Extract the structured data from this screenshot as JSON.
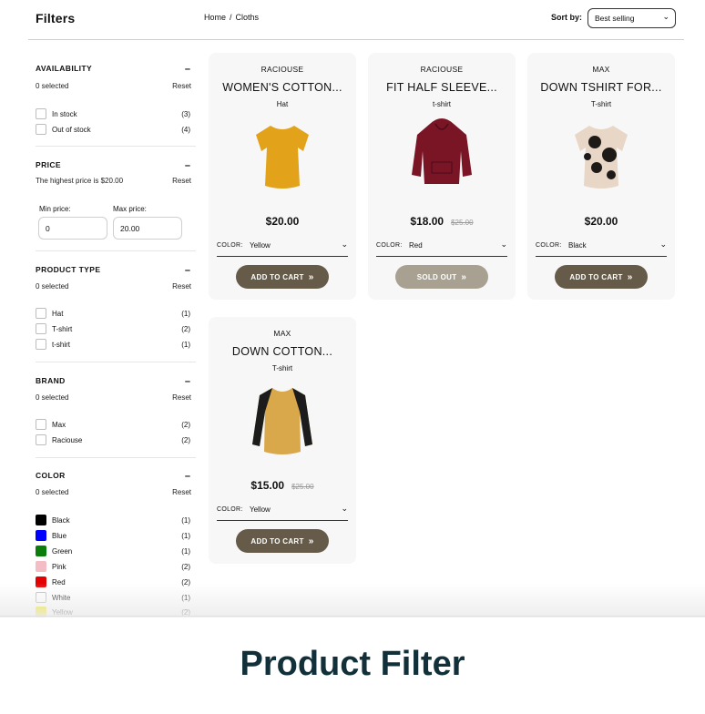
{
  "header": {
    "title": "Filters",
    "breadcrumb": [
      "Home",
      "Cloths"
    ],
    "breadcrumb_sep": "/",
    "sort_label": "Sort by:",
    "sort_value": "Best selling"
  },
  "filters": {
    "availability": {
      "title": "AVAILABILITY",
      "selected": "0 selected",
      "reset": "Reset",
      "options": [
        {
          "label": "In stock",
          "count": "(3)"
        },
        {
          "label": "Out of stock",
          "count": "(4)"
        }
      ]
    },
    "price": {
      "title": "PRICE",
      "highest": "The highest price is $20.00",
      "reset": "Reset",
      "min_label": "Min price:",
      "max_label": "Max price:",
      "min_value": "0",
      "max_value": "20.00"
    },
    "product_type": {
      "title": "PRODUCT TYPE",
      "selected": "0 selected",
      "reset": "Reset",
      "options": [
        {
          "label": "Hat",
          "count": "(1)"
        },
        {
          "label": "T-shirt",
          "count": "(2)"
        },
        {
          "label": "t-shirt",
          "count": "(1)"
        }
      ]
    },
    "brand": {
      "title": "BRAND",
      "selected": "0 selected",
      "reset": "Reset",
      "options": [
        {
          "label": "Max",
          "count": "(2)"
        },
        {
          "label": "Raciouse",
          "count": "(2)"
        }
      ]
    },
    "color": {
      "title": "COLOR",
      "selected": "0 selected",
      "reset": "Reset",
      "options": [
        {
          "label": "Black",
          "count": "(1)",
          "swatch": "#000000"
        },
        {
          "label": "Blue",
          "count": "(1)",
          "swatch": "#0000ff"
        },
        {
          "label": "Green",
          "count": "(1)",
          "swatch": "#0a7d0a"
        },
        {
          "label": "Pink",
          "count": "(2)",
          "swatch": "#f4bcc4"
        },
        {
          "label": "Red",
          "count": "(2)",
          "swatch": "#e30000"
        },
        {
          "label": "White",
          "count": "(1)",
          "swatch": "#ffffff"
        },
        {
          "label": "Yellow",
          "count": "(2)",
          "swatch": "#f1e400"
        }
      ]
    }
  },
  "products": [
    {
      "brand": "RACIOUSE",
      "name": "WOMEN'S COTTON...",
      "type": "Hat",
      "price": "$20.00",
      "was": "",
      "color_label": "COLOR:",
      "color": "Yellow",
      "button": "ADD TO CART",
      "sold_out": false,
      "garment_color": "#e2a21a"
    },
    {
      "brand": "RACIOUSE",
      "name": "FIT HALF SLEEVE...",
      "type": "t-shirt",
      "price": "$18.00",
      "was": "$25.00",
      "color_label": "COLOR:",
      "color": "Red",
      "button": "SOLD OUT",
      "sold_out": true,
      "garment_color": "#7a1526"
    },
    {
      "brand": "MAX",
      "name": "DOWN TSHIRT FOR...",
      "type": "T-shirt",
      "price": "$20.00",
      "was": "",
      "color_label": "COLOR:",
      "color": "Black",
      "button": "ADD TO CART",
      "sold_out": false,
      "garment_color": "#e8d6c6"
    },
    {
      "brand": "MAX",
      "name": "DOWN COTTON...",
      "type": "T-shirt",
      "price": "$15.00",
      "was": "$25.00",
      "color_label": "COLOR:",
      "color": "Yellow",
      "button": "ADD TO CART",
      "sold_out": false,
      "garment_color": "#d9a84a"
    }
  ],
  "footer": {
    "title": "Product Filter"
  },
  "colors": {
    "button": "#665b48",
    "button_soldout": "#a8a192",
    "card_bg": "#f7f7f7",
    "footer_text": "#12303a"
  }
}
